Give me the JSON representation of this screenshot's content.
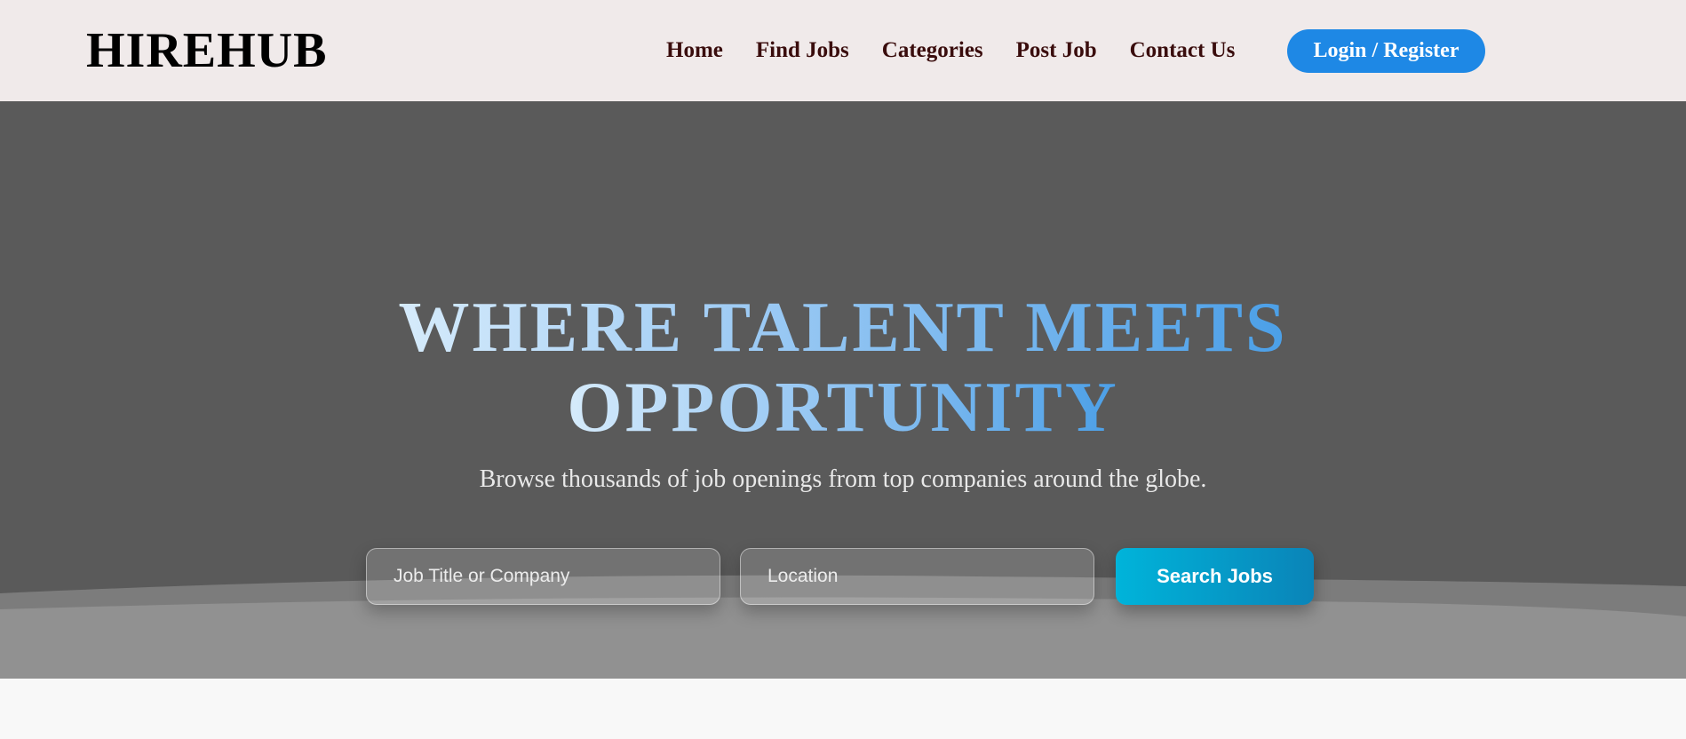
{
  "header": {
    "logo": "HIREHUB",
    "nav": [
      "Home",
      "Find Jobs",
      "Categories",
      "Post Job",
      "Contact Us"
    ],
    "login_label": "Login / Register"
  },
  "hero": {
    "title_line1": "WHERE TALENT MEETS",
    "title_line2": "OPPORTUNITY",
    "subtitle": "Browse thousands of job openings from top companies around the globe.",
    "search": {
      "job_placeholder": "Job Title or Company",
      "location_placeholder": "Location",
      "button_label": "Search Jobs"
    }
  },
  "colors": {
    "header_bg": "#f0eaea",
    "hero_bg": "#5a5a5a",
    "login_button": "#1e88e5",
    "search_button": "#00b4da"
  }
}
